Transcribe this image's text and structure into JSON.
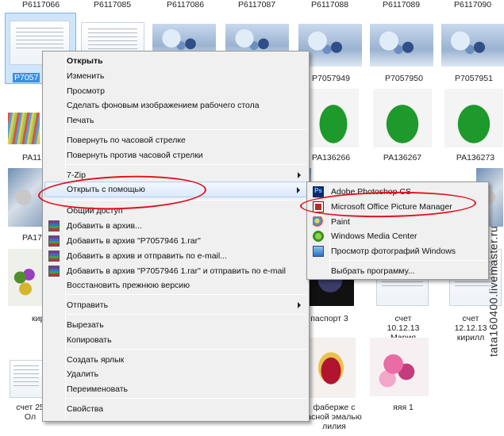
{
  "thumbnails": [
    {
      "caption": "P6117066",
      "art": "beads"
    },
    {
      "caption": "P6117085",
      "art": "beads"
    },
    {
      "caption": "P6117086",
      "art": "beads"
    },
    {
      "caption": "P6117087",
      "art": "beads"
    },
    {
      "caption": "P6117088",
      "art": "beads"
    },
    {
      "caption": "P6117089",
      "art": "beads"
    },
    {
      "caption": "P6117090",
      "art": "beads"
    },
    {
      "caption": "P7057",
      "art": "doc",
      "selected": true
    },
    {
      "caption": "P7057949",
      "art": "beads"
    },
    {
      "caption": "P7057950",
      "art": "beads"
    },
    {
      "caption": "P7057951",
      "art": "beads"
    },
    {
      "caption": "PA11",
      "art": "pencils"
    },
    {
      "caption": "PA136266",
      "art": "frog"
    },
    {
      "caption": "PA136267",
      "art": "frog"
    },
    {
      "caption": "PA136273",
      "art": "frog"
    },
    {
      "caption": "PA17",
      "art": "crystal"
    },
    {
      "caption": "",
      "art": "crystal"
    },
    {
      "caption": "",
      "art": "crystal"
    },
    {
      "caption": "",
      "art": "crystal"
    },
    {
      "caption": "кир",
      "art": "multi"
    },
    {
      "caption": "паспорт 3",
      "art": "dark"
    },
    {
      "caption": "счет 10.12.13 Мария",
      "art": "doc"
    },
    {
      "caption": "счет 12.12.13 кирилл",
      "art": "doc"
    },
    {
      "caption": "счет 25 Ол",
      "art": "doc"
    },
    {
      "caption": "фаберже с асной эмалью лилия",
      "art": "egg"
    },
    {
      "caption": "яяя 1",
      "art": "pink"
    }
  ],
  "context_menu": {
    "items": [
      {
        "label": "Открыть",
        "bold": true
      },
      {
        "label": "Изменить"
      },
      {
        "label": "Просмотр"
      },
      {
        "label": "Сделать фоновым изображением рабочего стола"
      },
      {
        "label": "Печать"
      },
      {
        "sep": true
      },
      {
        "label": "Повернуть по часовой стрелке"
      },
      {
        "label": "Повернуть против часовой стрелки"
      },
      {
        "sep": true
      },
      {
        "label": "7-Zip",
        "submenu": true
      },
      {
        "label": "Открыть с помощью",
        "submenu": true,
        "hover": true
      },
      {
        "sep": true
      },
      {
        "label": "Общий доступ"
      },
      {
        "label": "Добавить в архив...",
        "icon": "winrar-icon"
      },
      {
        "label": "Добавить в архив \"P7057946 1.rar\"",
        "icon": "winrar-icon"
      },
      {
        "label": "Добавить в архив и отправить по e-mail...",
        "icon": "winrar-icon"
      },
      {
        "label": "Добавить в архив \"P7057946 1.rar\" и отправить по e-mail",
        "icon": "winrar-icon"
      },
      {
        "label": "Восстановить прежнюю версию"
      },
      {
        "sep": true
      },
      {
        "label": "Отправить",
        "submenu": true
      },
      {
        "sep": true
      },
      {
        "label": "Вырезать"
      },
      {
        "label": "Копировать"
      },
      {
        "sep": true
      },
      {
        "label": "Создать ярлык"
      },
      {
        "label": "Удалить"
      },
      {
        "label": "Переименовать"
      },
      {
        "sep": true
      },
      {
        "label": "Свойства"
      }
    ]
  },
  "open_with_menu": {
    "items": [
      {
        "label": "Adobe Photoshop CS",
        "icon": "photoshop-icon"
      },
      {
        "label": "Microsoft Office Picture Manager",
        "icon": "picture-manager-icon"
      },
      {
        "label": "Paint",
        "icon": "paint-icon"
      },
      {
        "label": "Windows Media Center",
        "icon": "media-center-icon"
      },
      {
        "label": "Просмотр фотографий Windows",
        "icon": "photo-viewer-icon"
      },
      {
        "sep": true
      },
      {
        "label": "Выбрать программу..."
      }
    ]
  },
  "watermark": "tata160400.livemaster.ru"
}
